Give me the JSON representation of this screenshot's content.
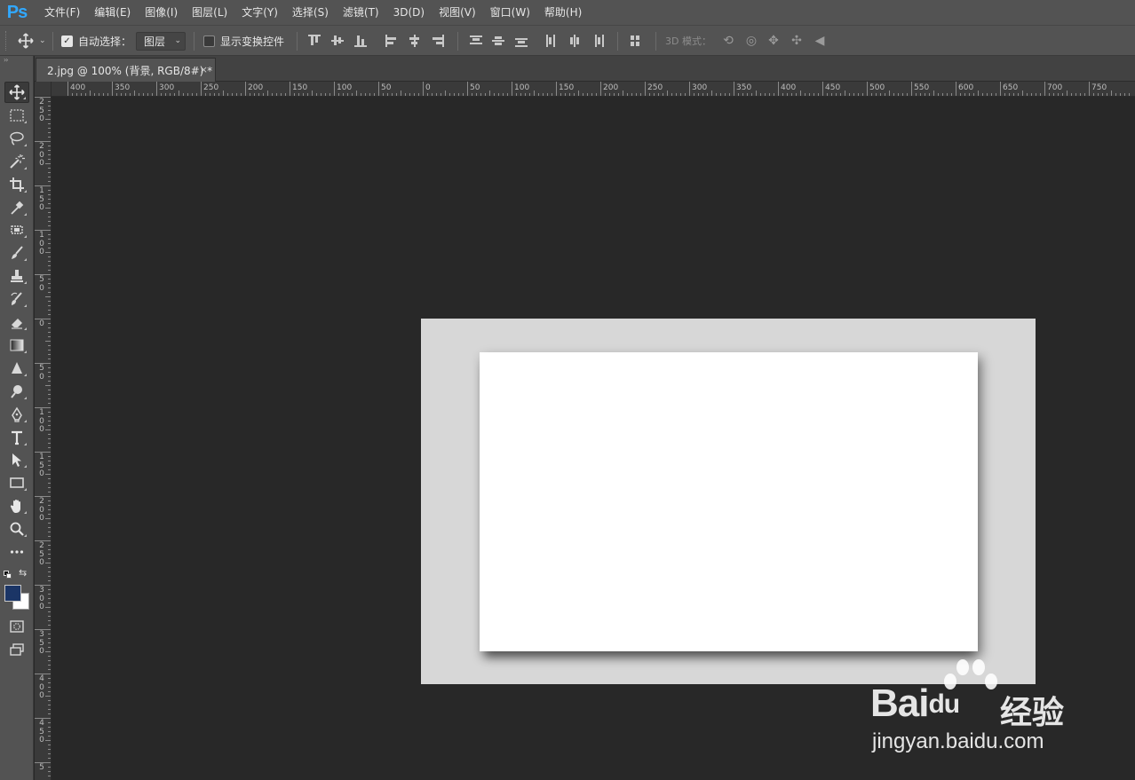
{
  "app": {
    "logo": "Ps"
  },
  "menu": [
    "文件(F)",
    "编辑(E)",
    "图像(I)",
    "图层(L)",
    "文字(Y)",
    "选择(S)",
    "滤镜(T)",
    "3D(D)",
    "视图(V)",
    "窗口(W)",
    "帮助(H)"
  ],
  "options": {
    "auto_select_label": "自动选择：",
    "auto_select_checked": true,
    "layer_select_value": "图层",
    "show_transform_label": "显示变换控件",
    "show_transform_checked": false,
    "mode3d_label": "3D 模式："
  },
  "document_tab": {
    "title": "2.jpg @ 100% (背景, RGB/8#) *",
    "close": "×"
  },
  "ruler_top_labels": [
    "400",
    "350",
    "300",
    "250",
    "200",
    "150",
    "100",
    "50",
    "0",
    "50",
    "100",
    "150",
    "200",
    "250",
    "300",
    "350",
    "400",
    "450",
    "500",
    "550",
    "600",
    "650",
    "700",
    "750"
  ],
  "ruler_left_labels": [
    "2\n5\n0",
    "2\n0\n0",
    "1\n5\n0",
    "1\n0\n0",
    "5\n0",
    "0",
    "5\n0",
    "1\n0\n0",
    "1\n5\n0",
    "2\n0\n0",
    "2\n5\n0",
    "3\n0\n0",
    "3\n5\n0",
    "4\n0\n0",
    "4\n5\n0",
    "5"
  ],
  "tools": [
    {
      "name": "move-tool-icon",
      "glyph": "move"
    },
    {
      "name": "marquee-tool-icon",
      "glyph": "marquee"
    },
    {
      "name": "lasso-tool-icon",
      "glyph": "lasso"
    },
    {
      "name": "magic-wand-tool-icon",
      "glyph": "wand"
    },
    {
      "name": "crop-tool-icon",
      "glyph": "crop"
    },
    {
      "name": "eyedropper-tool-icon",
      "glyph": "eyedropper"
    },
    {
      "name": "healing-brush-tool-icon",
      "glyph": "patch"
    },
    {
      "name": "brush-tool-icon",
      "glyph": "brush"
    },
    {
      "name": "clone-stamp-tool-icon",
      "glyph": "stamp"
    },
    {
      "name": "history-brush-tool-icon",
      "glyph": "history"
    },
    {
      "name": "eraser-tool-icon",
      "glyph": "eraser"
    },
    {
      "name": "gradient-tool-icon",
      "glyph": "gradient"
    },
    {
      "name": "blur-tool-icon",
      "glyph": "blur"
    },
    {
      "name": "dodge-tool-icon",
      "glyph": "dodge"
    },
    {
      "name": "pen-tool-icon",
      "glyph": "pen"
    },
    {
      "name": "type-tool-icon",
      "glyph": "type"
    },
    {
      "name": "path-selection-tool-icon",
      "glyph": "arrow"
    },
    {
      "name": "rectangle-tool-icon",
      "glyph": "rect"
    },
    {
      "name": "hand-tool-icon",
      "glyph": "hand"
    },
    {
      "name": "zoom-tool-icon",
      "glyph": "zoom"
    },
    {
      "name": "more-tools-icon",
      "glyph": "dots"
    }
  ],
  "colors": {
    "foreground": "#1b3566",
    "background": "#ffffff",
    "canvas_bg": "#d7d7d7",
    "paper": "#ffffff",
    "workspace": "#282828"
  },
  "watermark": {
    "brand": "Bai",
    "brand_suffix": "du",
    "cn": "经验",
    "url": "jingyan.baidu.com"
  }
}
